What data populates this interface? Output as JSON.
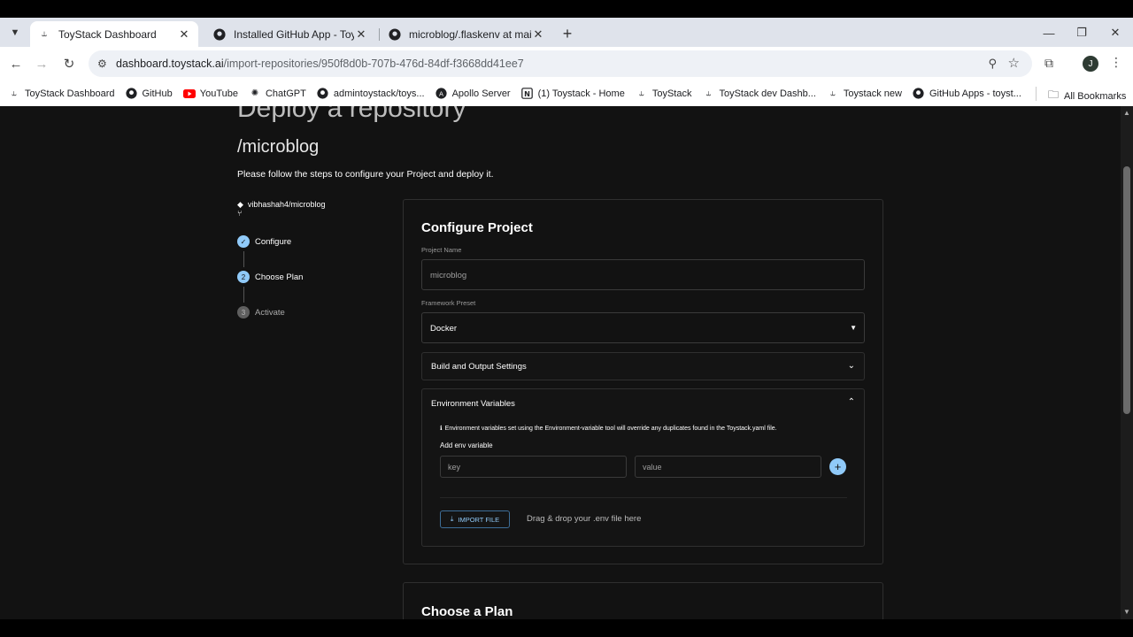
{
  "browser": {
    "tabs": [
      {
        "title": "ToyStack Dashboard",
        "icon": "toystack-icon",
        "active": true
      },
      {
        "title": "Installed GitHub App - Toystack",
        "icon": "github-icon",
        "active": false
      },
      {
        "title": "microblog/.flaskenv at main · m",
        "icon": "github-icon",
        "active": false
      }
    ],
    "new_tab": "+",
    "url_host": "dashboard.toystack.ai",
    "url_path": "/import-repositories/950f8d0b-707b-476d-84df-f3668dd41ee7",
    "avatar_initial": "J",
    "bookmarks": [
      {
        "label": "ToyStack Dashboard",
        "icon": "toystack-icon"
      },
      {
        "label": "GitHub",
        "icon": "github-icon"
      },
      {
        "label": "YouTube",
        "icon": "youtube-icon"
      },
      {
        "label": "ChatGPT",
        "icon": "chatgpt-icon"
      },
      {
        "label": "admintoystack/toys...",
        "icon": "github-icon"
      },
      {
        "label": "Apollo Server",
        "icon": "apollo-icon"
      },
      {
        "label": "(1) Toystack - Home",
        "icon": "notion-icon"
      },
      {
        "label": "ToyStack",
        "icon": "toystack-icon"
      },
      {
        "label": "ToyStack dev Dashb...",
        "icon": "toystack-icon"
      },
      {
        "label": "Toystack new",
        "icon": "toystack-icon"
      },
      {
        "label": "GitHub Apps - toyst...",
        "icon": "github-icon"
      }
    ],
    "all_bookmarks": "All Bookmarks"
  },
  "page": {
    "heading": "Deploy a repository",
    "repo_name": "/microblog",
    "intro": "Please follow the steps to configure your Project and deploy it.",
    "repo_path": "vibhashah4/microblog",
    "steps": [
      {
        "num": "✓",
        "label": "Configure",
        "state": "done"
      },
      {
        "num": "2",
        "label": "Choose Plan",
        "state": "active"
      },
      {
        "num": "3",
        "label": "Activate",
        "state": "pending"
      }
    ]
  },
  "configure": {
    "title": "Configure Project",
    "project_name_label": "Project Name",
    "project_name_value": "microblog",
    "framework_label": "Framework Preset",
    "framework_value": "Docker",
    "build_settings": "Build and Output Settings",
    "env_vars": "Environment Variables",
    "env_note": "Environment variables set using the Environment-variable tool will override any duplicates found in the Toystack.yaml file.",
    "add_env": "Add env variable",
    "key_placeholder": "key",
    "value_placeholder": "value",
    "import_button": "IMPORT FILE",
    "drag_text": "Drag & drop your .env file here"
  },
  "plan": {
    "title": "Choose a Plan"
  },
  "colors": {
    "accent": "#90caf9",
    "background": "#121212"
  }
}
